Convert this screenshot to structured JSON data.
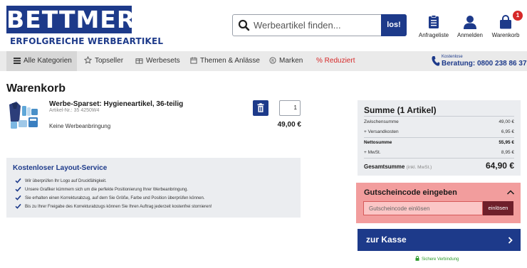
{
  "brand": {
    "logo_text": "BETTMER",
    "tagline": "ERFOLGREICHE WERBEARTIKEL",
    "accent": "#1d3a8a",
    "sale_color": "#d62828"
  },
  "search": {
    "placeholder": "Werbeartikel finden...",
    "button_label": "los!"
  },
  "header_actions": [
    {
      "label": "Anfrageliste",
      "icon": "clipboard-icon"
    },
    {
      "label": "Anmelden",
      "icon": "user-icon"
    },
    {
      "label": "Warenkorb",
      "icon": "shopping-bag-icon",
      "badge": "1"
    }
  ],
  "nav": {
    "items": [
      {
        "label": "Alle Kategorien",
        "icon": "menu-icon"
      },
      {
        "label": "Topseller",
        "icon": "star-icon"
      },
      {
        "label": "Werbesets",
        "icon": "gift-icon"
      },
      {
        "label": "Themen & Anlässe",
        "icon": "calendar-icon"
      },
      {
        "label": "Marken",
        "icon": "registered-icon"
      },
      {
        "label": "Reduziert",
        "icon": "percent-icon"
      }
    ],
    "hotline_small": "Kostenlose",
    "hotline": "Beratung: 0800 238 86 37"
  },
  "cart": {
    "title": "Warenkorb",
    "item": {
      "name": "Werbe-Sparset: Hygieneartikel, 36-teilig",
      "article_no": "Artikel-Nr.: 35 4250W4",
      "note": "Keine Werbeanbringung",
      "quantity": "1",
      "price": "49,00 €"
    }
  },
  "layout_service": {
    "title": "Kostenloser Layout-Service",
    "points": [
      "Wir überprüfen Ihr Logo auf Druckfähigkeit.",
      "Unsere Grafiker kümmern sich um die perfekte Positionierung Ihrer Werbeanbringung.",
      "Sie erhalten einen Korrekturabzug, auf dem Sie Größe, Farbe und Position überprüfen können.",
      "Bis zu Ihrer Freigabe des Korrekturabzugs können Sie Ihren Auftrag jederzeit kostenfrei stornieren!"
    ]
  },
  "summary": {
    "title": "Summe (1 Artikel)",
    "lines": [
      {
        "label": "Zwischensumme",
        "value": "49,00 €"
      },
      {
        "label": "+ Versandkosten",
        "value": "6,95 €"
      },
      {
        "label": "Nettosumme",
        "value": "55,95 €"
      },
      {
        "label": "+ MwSt.",
        "value": "8,95 €"
      }
    ],
    "total_label": "Gesamtsumme",
    "total_note": "(inkl. MwSt.)",
    "total_value": "64,90 €"
  },
  "coupon": {
    "title": "Gutscheincode eingeben",
    "placeholder": "Gutscheincode einlösen",
    "button_label": "einlösen"
  },
  "checkout": {
    "button_label": "zur Kasse",
    "secure_label": "Sichere Verbindung"
  }
}
